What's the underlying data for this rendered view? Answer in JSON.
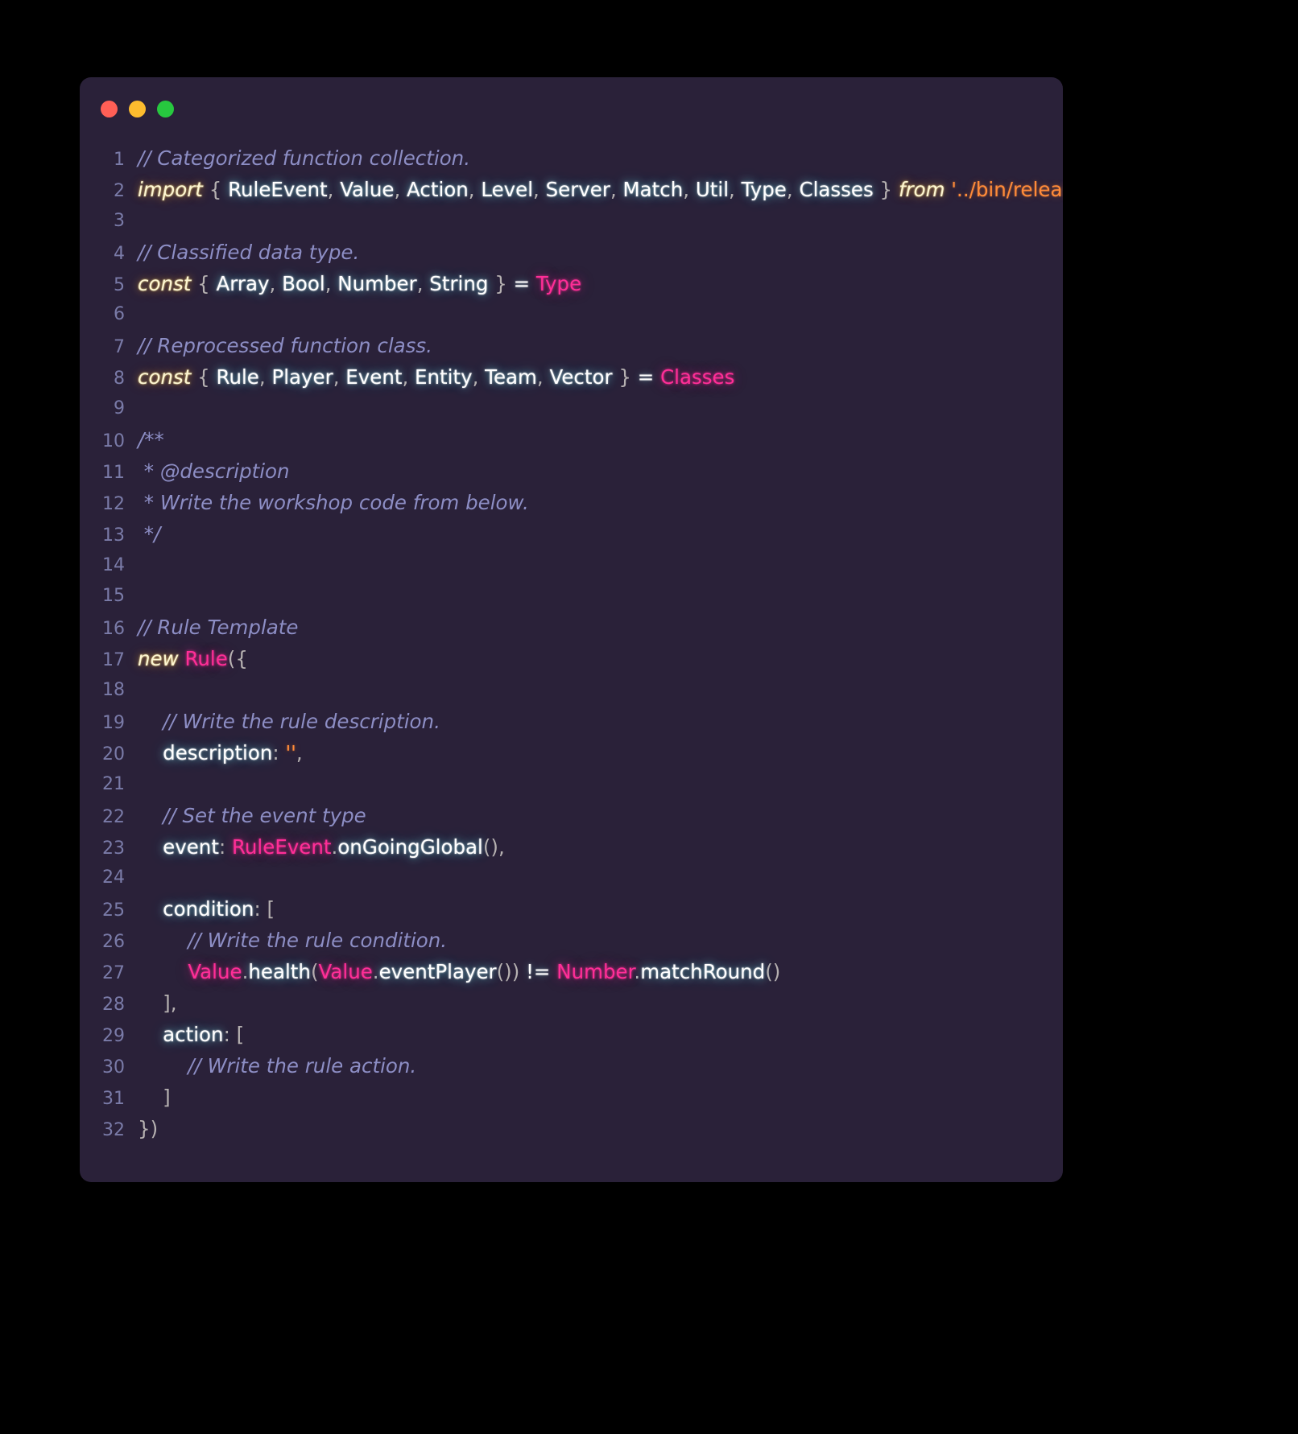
{
  "window": {
    "title": "",
    "controls": [
      {
        "name": "close",
        "color": "#ff5f56"
      },
      {
        "name": "minimize",
        "color": "#fdbc2e"
      },
      {
        "name": "maximize",
        "color": "#27c83f"
      }
    ]
  },
  "theme": {
    "page_background": "#000000",
    "editor_background": "#2a2139",
    "line_number_color": "#7a7ba8",
    "comment_color": "#8d8ec5",
    "keyword_color": "#fdf6d3",
    "identifier_color": "#ffffff",
    "class_color": "#ff2e97",
    "string_color": "#ff8b39",
    "punctuation_color": "#b6b1b1"
  },
  "editor": {
    "language": "javascript",
    "total_lines": 32,
    "lines": [
      {
        "n": "1",
        "tokens": [
          {
            "t": "comment",
            "v": "// Categorized function collection."
          }
        ]
      },
      {
        "n": "2",
        "tokens": [
          {
            "t": "kw",
            "v": "import"
          },
          {
            "t": "punc",
            "v": " { "
          },
          {
            "t": "ident",
            "v": "RuleEvent"
          },
          {
            "t": "punc",
            "v": ", "
          },
          {
            "t": "ident",
            "v": "Value"
          },
          {
            "t": "punc",
            "v": ", "
          },
          {
            "t": "ident",
            "v": "Action"
          },
          {
            "t": "punc",
            "v": ", "
          },
          {
            "t": "ident",
            "v": "Level"
          },
          {
            "t": "punc",
            "v": ", "
          },
          {
            "t": "ident",
            "v": "Server"
          },
          {
            "t": "punc",
            "v": ", "
          },
          {
            "t": "ident",
            "v": "Match"
          },
          {
            "t": "punc",
            "v": ", "
          },
          {
            "t": "ident",
            "v": "Util"
          },
          {
            "t": "punc",
            "v": ", "
          },
          {
            "t": "ident",
            "v": "Type"
          },
          {
            "t": "punc",
            "v": ", "
          },
          {
            "t": "ident",
            "v": "Classes"
          },
          {
            "t": "punc",
            "v": " } "
          },
          {
            "t": "kw",
            "v": "from"
          },
          {
            "t": "punc",
            "v": " "
          },
          {
            "t": "str",
            "v": "'../bin/release/eng'"
          }
        ]
      },
      {
        "n": "3",
        "tokens": []
      },
      {
        "n": "4",
        "tokens": [
          {
            "t": "comment",
            "v": "// Classified data type."
          }
        ]
      },
      {
        "n": "5",
        "tokens": [
          {
            "t": "kw",
            "v": "const"
          },
          {
            "t": "punc",
            "v": " { "
          },
          {
            "t": "ident",
            "v": "Array"
          },
          {
            "t": "punc",
            "v": ", "
          },
          {
            "t": "ident",
            "v": "Bool"
          },
          {
            "t": "punc",
            "v": ", "
          },
          {
            "t": "ident",
            "v": "Number"
          },
          {
            "t": "punc",
            "v": ", "
          },
          {
            "t": "ident",
            "v": "String"
          },
          {
            "t": "punc",
            "v": " } "
          },
          {
            "t": "op",
            "v": "="
          },
          {
            "t": "punc",
            "v": " "
          },
          {
            "t": "class",
            "v": "Type"
          }
        ]
      },
      {
        "n": "6",
        "tokens": []
      },
      {
        "n": "7",
        "tokens": [
          {
            "t": "comment",
            "v": "// Reprocessed function class."
          }
        ]
      },
      {
        "n": "8",
        "tokens": [
          {
            "t": "kw",
            "v": "const"
          },
          {
            "t": "punc",
            "v": " { "
          },
          {
            "t": "ident",
            "v": "Rule"
          },
          {
            "t": "punc",
            "v": ", "
          },
          {
            "t": "ident",
            "v": "Player"
          },
          {
            "t": "punc",
            "v": ", "
          },
          {
            "t": "ident",
            "v": "Event"
          },
          {
            "t": "punc",
            "v": ", "
          },
          {
            "t": "ident",
            "v": "Entity"
          },
          {
            "t": "punc",
            "v": ", "
          },
          {
            "t": "ident",
            "v": "Team"
          },
          {
            "t": "punc",
            "v": ", "
          },
          {
            "t": "ident",
            "v": "Vector"
          },
          {
            "t": "punc",
            "v": " } "
          },
          {
            "t": "op",
            "v": "="
          },
          {
            "t": "punc",
            "v": " "
          },
          {
            "t": "class",
            "v": "Classes"
          }
        ]
      },
      {
        "n": "9",
        "tokens": []
      },
      {
        "n": "10",
        "tokens": [
          {
            "t": "comment",
            "v": "/**"
          }
        ]
      },
      {
        "n": "11",
        "tokens": [
          {
            "t": "comment",
            "v": " * @description"
          }
        ]
      },
      {
        "n": "12",
        "tokens": [
          {
            "t": "comment",
            "v": " * Write the workshop code from below."
          }
        ]
      },
      {
        "n": "13",
        "tokens": [
          {
            "t": "comment",
            "v": " */"
          }
        ]
      },
      {
        "n": "14",
        "tokens": []
      },
      {
        "n": "15",
        "tokens": []
      },
      {
        "n": "16",
        "tokens": [
          {
            "t": "comment",
            "v": "// Rule Template"
          }
        ]
      },
      {
        "n": "17",
        "tokens": [
          {
            "t": "kw",
            "v": "new"
          },
          {
            "t": "punc",
            "v": " "
          },
          {
            "t": "class",
            "v": "Rule"
          },
          {
            "t": "punc",
            "v": "({"
          }
        ]
      },
      {
        "n": "18",
        "tokens": []
      },
      {
        "n": "19",
        "tokens": [
          {
            "t": "comment",
            "v": "    // Write the rule description."
          }
        ]
      },
      {
        "n": "20",
        "tokens": [
          {
            "t": "plain",
            "v": "    "
          },
          {
            "t": "ident",
            "v": "description"
          },
          {
            "t": "punc",
            "v": ": "
          },
          {
            "t": "str",
            "v": "''"
          },
          {
            "t": "punc",
            "v": ","
          }
        ]
      },
      {
        "n": "21",
        "tokens": []
      },
      {
        "n": "22",
        "tokens": [
          {
            "t": "comment",
            "v": "    // Set the event type"
          }
        ]
      },
      {
        "n": "23",
        "tokens": [
          {
            "t": "plain",
            "v": "    "
          },
          {
            "t": "ident",
            "v": "event"
          },
          {
            "t": "punc",
            "v": ": "
          },
          {
            "t": "class",
            "v": "RuleEvent"
          },
          {
            "t": "punc",
            "v": "."
          },
          {
            "t": "ident",
            "v": "onGoingGlobal"
          },
          {
            "t": "punc",
            "v": "(),"
          }
        ]
      },
      {
        "n": "24",
        "tokens": []
      },
      {
        "n": "25",
        "tokens": [
          {
            "t": "plain",
            "v": "    "
          },
          {
            "t": "ident",
            "v": "condition"
          },
          {
            "t": "punc",
            "v": ": ["
          }
        ]
      },
      {
        "n": "26",
        "tokens": [
          {
            "t": "comment",
            "v": "        // Write the rule condition."
          }
        ]
      },
      {
        "n": "27",
        "tokens": [
          {
            "t": "plain",
            "v": "        "
          },
          {
            "t": "class",
            "v": "Value"
          },
          {
            "t": "punc",
            "v": "."
          },
          {
            "t": "ident",
            "v": "health"
          },
          {
            "t": "punc",
            "v": "("
          },
          {
            "t": "class",
            "v": "Value"
          },
          {
            "t": "punc",
            "v": "."
          },
          {
            "t": "ident",
            "v": "eventPlayer"
          },
          {
            "t": "punc",
            "v": "()) "
          },
          {
            "t": "op",
            "v": "!="
          },
          {
            "t": "punc",
            "v": " "
          },
          {
            "t": "class",
            "v": "Number"
          },
          {
            "t": "punc",
            "v": "."
          },
          {
            "t": "ident",
            "v": "matchRound"
          },
          {
            "t": "punc",
            "v": "()"
          }
        ]
      },
      {
        "n": "28",
        "tokens": [
          {
            "t": "punc",
            "v": "    ],"
          }
        ]
      },
      {
        "n": "29",
        "tokens": [
          {
            "t": "plain",
            "v": "    "
          },
          {
            "t": "ident",
            "v": "action"
          },
          {
            "t": "punc",
            "v": ": ["
          }
        ]
      },
      {
        "n": "30",
        "tokens": [
          {
            "t": "comment",
            "v": "        // Write the rule action."
          }
        ]
      },
      {
        "n": "31",
        "tokens": [
          {
            "t": "punc",
            "v": "    ]"
          }
        ]
      },
      {
        "n": "32",
        "tokens": [
          {
            "t": "punc",
            "v": "})"
          }
        ]
      }
    ]
  }
}
